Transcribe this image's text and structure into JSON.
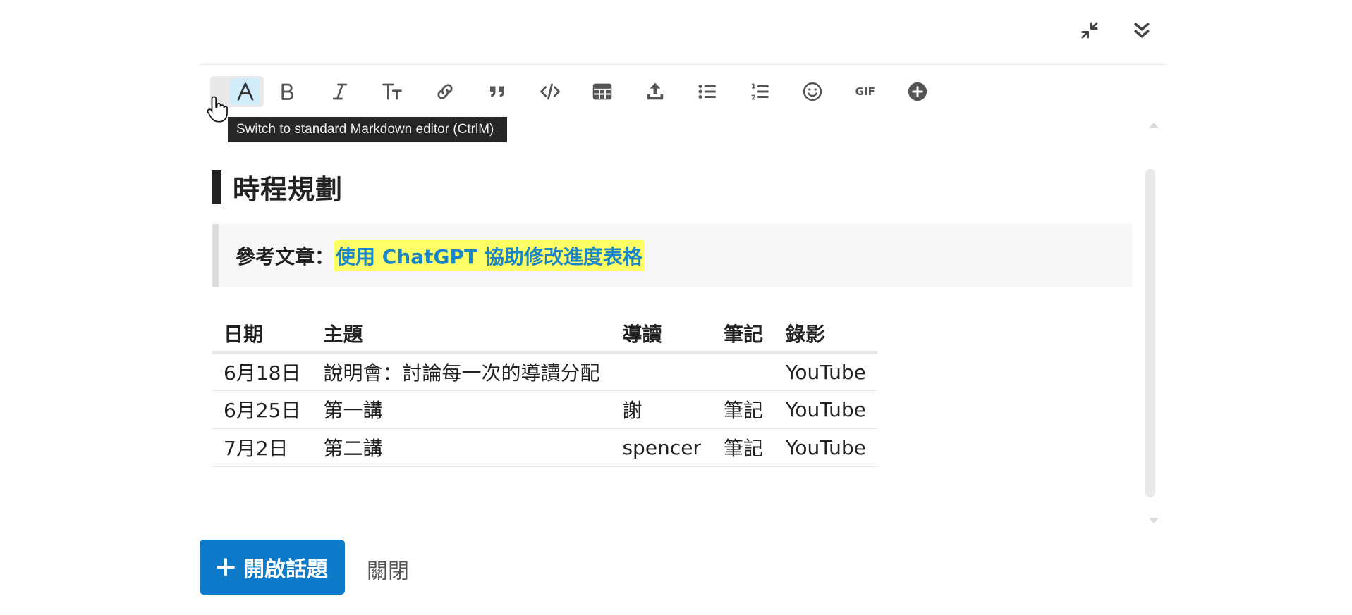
{
  "window_controls": {
    "minimize_icon": "collapse-arrows-icon",
    "hide_icon": "double-chevron-down-icon"
  },
  "toolbar": {
    "buttons": [
      {
        "name": "rich-text-toggle",
        "icon": "font-a-icon"
      },
      {
        "name": "bold",
        "icon": "bold-icon"
      },
      {
        "name": "italic",
        "icon": "italic-icon"
      },
      {
        "name": "heading",
        "icon": "text-size-icon"
      },
      {
        "name": "link",
        "icon": "link-icon"
      },
      {
        "name": "quote",
        "icon": "quote-icon"
      },
      {
        "name": "code",
        "icon": "code-icon"
      },
      {
        "name": "table",
        "icon": "table-icon"
      },
      {
        "name": "upload",
        "icon": "upload-icon"
      },
      {
        "name": "bullet-list",
        "icon": "bullet-list-icon"
      },
      {
        "name": "numbered-list",
        "icon": "numbered-list-icon"
      },
      {
        "name": "emoji",
        "icon": "smiley-icon"
      },
      {
        "name": "gif",
        "icon": "gif-icon"
      },
      {
        "name": "more",
        "icon": "plus-circle-icon"
      }
    ],
    "gif_label": "GIF",
    "tooltip": "Switch to standard Markdown editor (CtrlM)"
  },
  "editor": {
    "heading": "時程規劃",
    "quote_label": "參考文章：",
    "quote_link": "使用 ChatGPT 協助修改進度表格",
    "table": {
      "headers": [
        "日期",
        "主題",
        "導讀",
        "筆記",
        "錄影"
      ],
      "rows": [
        [
          "6月18日",
          "說明會：討論每一次的導讀分配",
          "",
          "",
          "YouTube"
        ],
        [
          "6月25日",
          "第一講",
          "謝",
          "筆記",
          "YouTube"
        ],
        [
          "7月2日",
          "第二講",
          "spencer",
          "筆記",
          "YouTube"
        ]
      ]
    }
  },
  "footer": {
    "create_topic_label": "開啟話題",
    "close_label": "關閉"
  },
  "colors": {
    "primary": "#0d7bc9",
    "link": "#1a86c8",
    "highlight": "#ffff66",
    "toggle_active": "#d1ecfb"
  }
}
